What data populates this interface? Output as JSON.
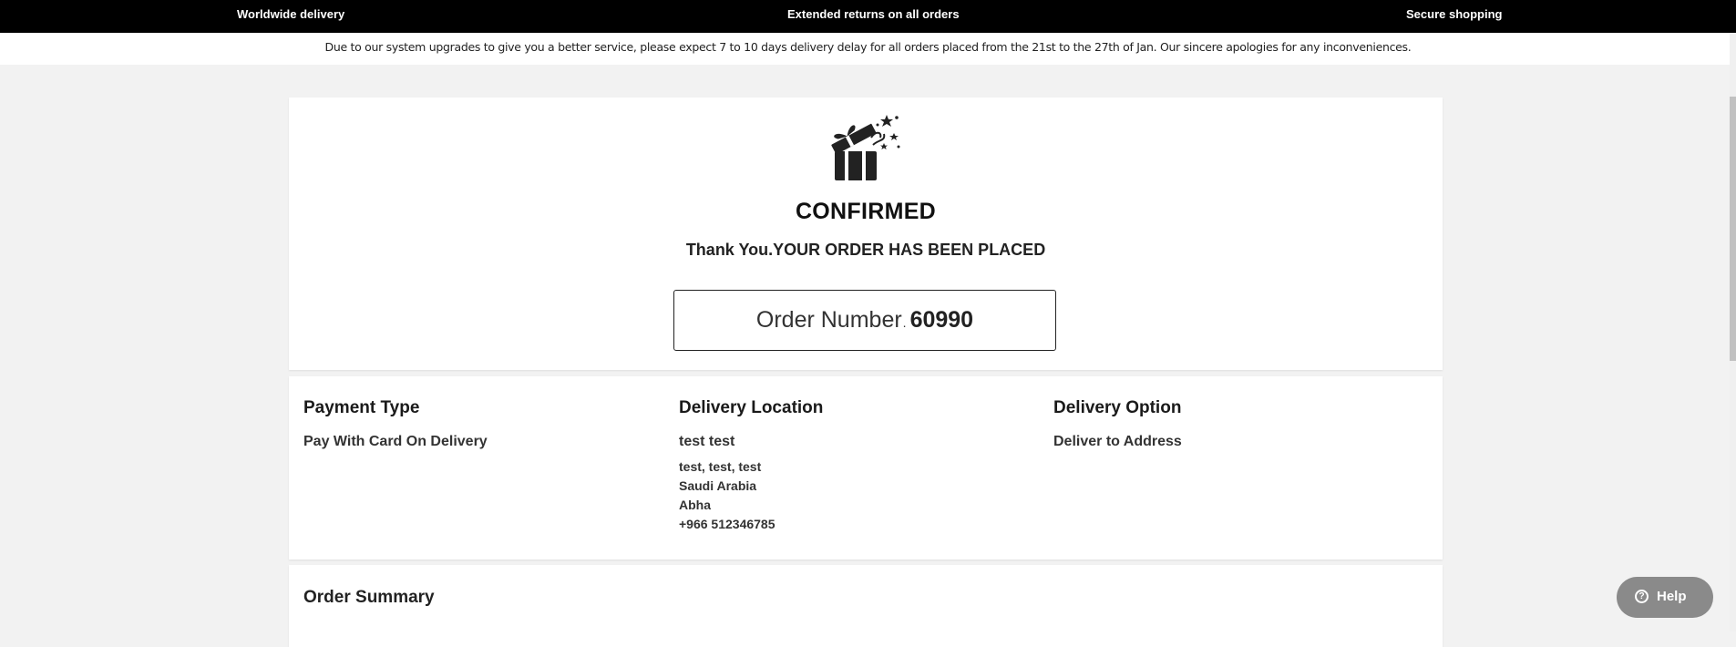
{
  "topbar": {
    "left": "Worldwide delivery",
    "center": "Extended returns on all orders",
    "right": "Secure shopping"
  },
  "notice": "Due to our system upgrades to give you a better service, please expect 7 to 10 days delivery delay for all orders placed from the 21st to the 27th of Jan. Our sincere apologies for any inconveniences.",
  "confirmation": {
    "icon": "gift-box-icon",
    "status": "CONFIRMED",
    "message": "Thank You.YOUR ORDER HAS BEEN PLACED",
    "order_label": "Order Number",
    "order_number": "60990"
  },
  "details": {
    "payment": {
      "title": "Payment Type",
      "value": "Pay With Card On Delivery"
    },
    "location": {
      "title": "Delivery Location",
      "name": "test test",
      "address_lines": [
        "test, test, test",
        "Saudi Arabia",
        "Abha",
        "+966 512346785"
      ]
    },
    "option": {
      "title": "Delivery Option",
      "value": "Deliver to Address"
    }
  },
  "summary": {
    "title": "Order Summary"
  },
  "help": {
    "label": "Help",
    "icon": "question-circle-icon"
  },
  "colors": {
    "topbar": "#000000",
    "background": "#f2f2f2",
    "help_button": "#8a8a8a"
  }
}
